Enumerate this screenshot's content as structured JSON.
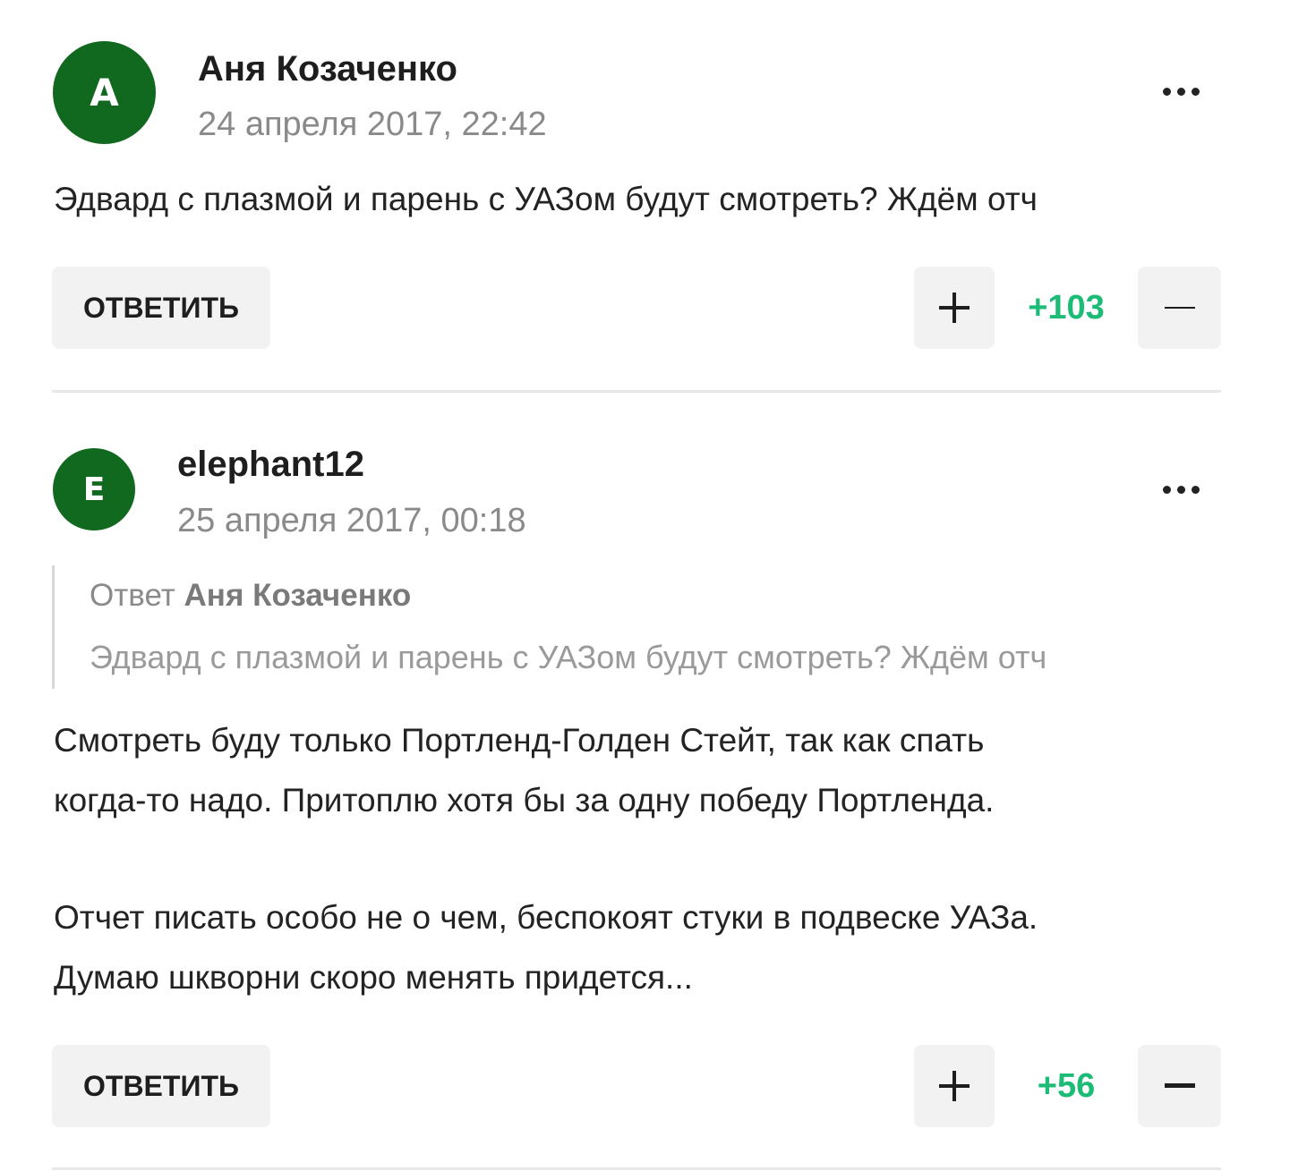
{
  "comments": [
    {
      "avatar_letter": "A",
      "author": "Аня Козаченко",
      "date": "24 апреля 2017, 22:42",
      "text": "Эдвард с плазмой и парень с УАЗом будут смотреть? Ждём отч",
      "reply_label": "ОТВЕТИТЬ",
      "score": "+103"
    },
    {
      "avatar_letter": "E",
      "author": "elephant12",
      "date": "25 апреля 2017, 00:18",
      "quote": {
        "prefix": "Ответ",
        "author": "Аня Козаченко",
        "text": "Эдвард с плазмой и парень с УАЗом будут смотреть? Ждём отч"
      },
      "paragraphs": [
        [
          "Смотреть буду только Портленд-Голден Стейт, так как спать",
          "когда-то надо. Притоплю хотя бы за одну победу Портленда."
        ],
        [
          "Отчет писать особо не о чем, беспокоят стуки в подвеске УАЗа.",
          "Думаю шкворни скоро менять придется..."
        ]
      ],
      "reply_label": "ОТВЕТИТЬ",
      "score": "+56"
    }
  ],
  "colors": {
    "avatar_bg": "#11681f",
    "score_positive": "#1cbc77",
    "button_bg": "#f2f2f2"
  },
  "icons": [
    "more-dots-icon",
    "plus-icon",
    "minus-icon"
  ]
}
